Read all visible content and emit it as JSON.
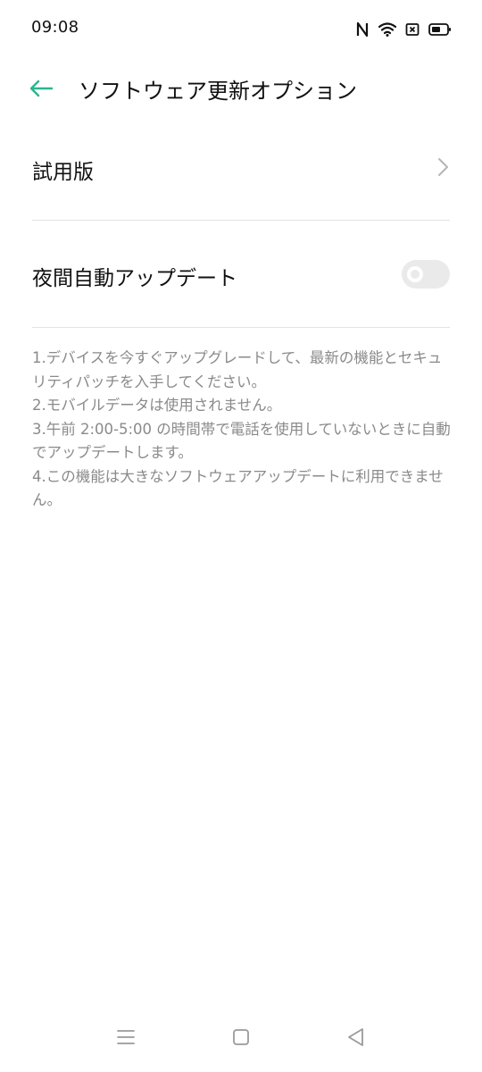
{
  "status_bar": {
    "time": "09:08",
    "icons": [
      "nfc-icon",
      "wifi-icon",
      "sim-off-icon",
      "battery-icon"
    ]
  },
  "header": {
    "back_icon": "arrow-left-icon",
    "title": "ソフトウェア更新オプション"
  },
  "colors": {
    "accent": "#2bb58e",
    "toggle_off": "#eaeaea",
    "note_text": "#8a8a8a"
  },
  "settings": {
    "trial": {
      "label": "試用版",
      "icon": "chevron-right-icon"
    },
    "night_update": {
      "label": "夜間自動アップデート",
      "enabled": false
    }
  },
  "notes": [
    "1.デバイスを今すぐアップグレードして、最新の機能とセキュリティパッチを入手してください。",
    "2.モバイルデータは使用されません。",
    "3.午前 2:00-5:00 の時間帯で電話を使用していないときに自動でアップデートします。",
    "4.この機能は大きなソフトウェアアップデートに利用できません。"
  ],
  "nav_bar": {
    "icons": [
      "menu-icon",
      "home-icon",
      "back-triangle-icon"
    ]
  }
}
